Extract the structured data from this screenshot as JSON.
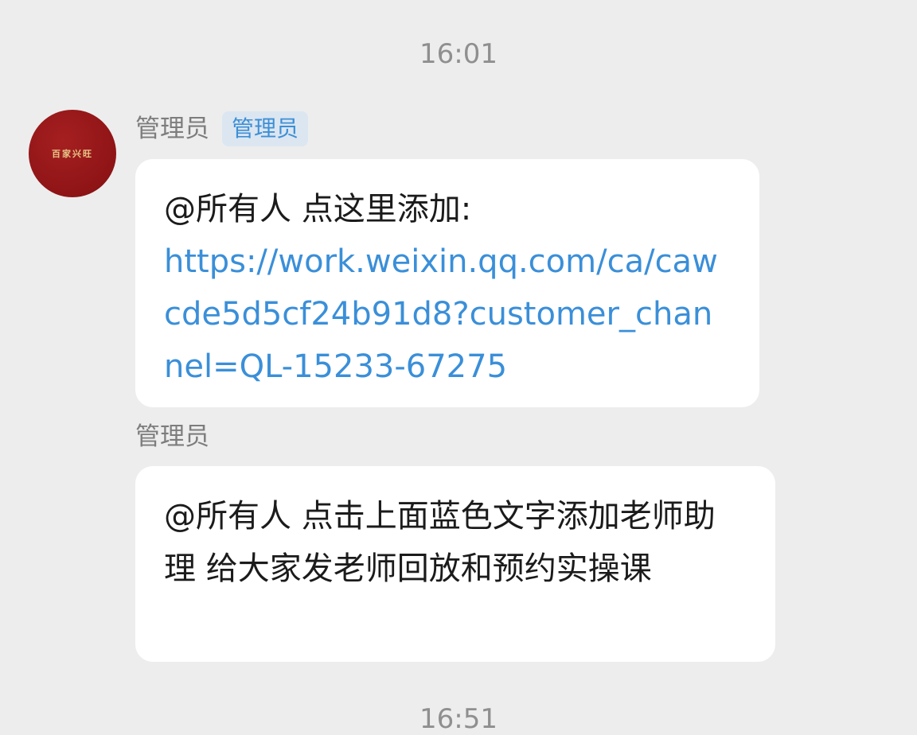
{
  "chat": {
    "time_top": "16:01",
    "time_bottom": "16:51",
    "messages": [
      {
        "sender": "管理员",
        "role_badge": "管理员",
        "avatar_text": "百家兴旺",
        "text": "@所有人 点这里添加:",
        "link": "https://work.weixin.qq.com/ca/cawcde5d5cf24b91d8?customer_channel=QL-15233-67275"
      },
      {
        "sender": "管理员",
        "text": "@所有人 点击上面蓝色文字添加老师助理 给大家发老师回放和预约实操课"
      }
    ]
  },
  "colors": {
    "background": "#ededed",
    "bubble": "#ffffff",
    "link": "#3a8fd9",
    "badge_bg": "#dbe6f1",
    "badge_text": "#3d8fd6",
    "avatar": "#8f1416"
  }
}
